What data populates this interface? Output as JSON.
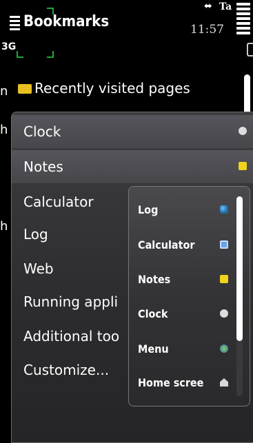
{
  "status_bar": {
    "title": "Bookmarks",
    "time": "11:57",
    "network": "3G",
    "indicator": "Ta"
  },
  "background_list": {
    "recent_label": "Recently visited pages",
    "edge_letters": [
      "n",
      "h",
      "h"
    ]
  },
  "menu": {
    "items": [
      {
        "label": "Clock",
        "icon": "clock-icon"
      },
      {
        "label": "Notes",
        "icon": "notes-icon"
      },
      {
        "label": "Calculator"
      },
      {
        "label": "Log"
      },
      {
        "label": "Web"
      },
      {
        "label": "Running appli"
      },
      {
        "label": "Additional too"
      },
      {
        "label": "Customize..."
      }
    ]
  },
  "submenu": {
    "items": [
      {
        "label": "Log",
        "icon": "log-icon"
      },
      {
        "label": "Calculator",
        "icon": "calculator-icon"
      },
      {
        "label": "Notes",
        "icon": "notes-icon"
      },
      {
        "label": "Clock",
        "icon": "clock-icon"
      },
      {
        "label": "Menu",
        "icon": "menu-icon"
      },
      {
        "label": "Home scree",
        "icon": "home-icon"
      }
    ]
  },
  "colors": {
    "menu_background": "#2c2c2f",
    "highlight": "#4e4e53",
    "note_yellow": "#f2d21a",
    "folder_yellow": "#e8c020"
  }
}
